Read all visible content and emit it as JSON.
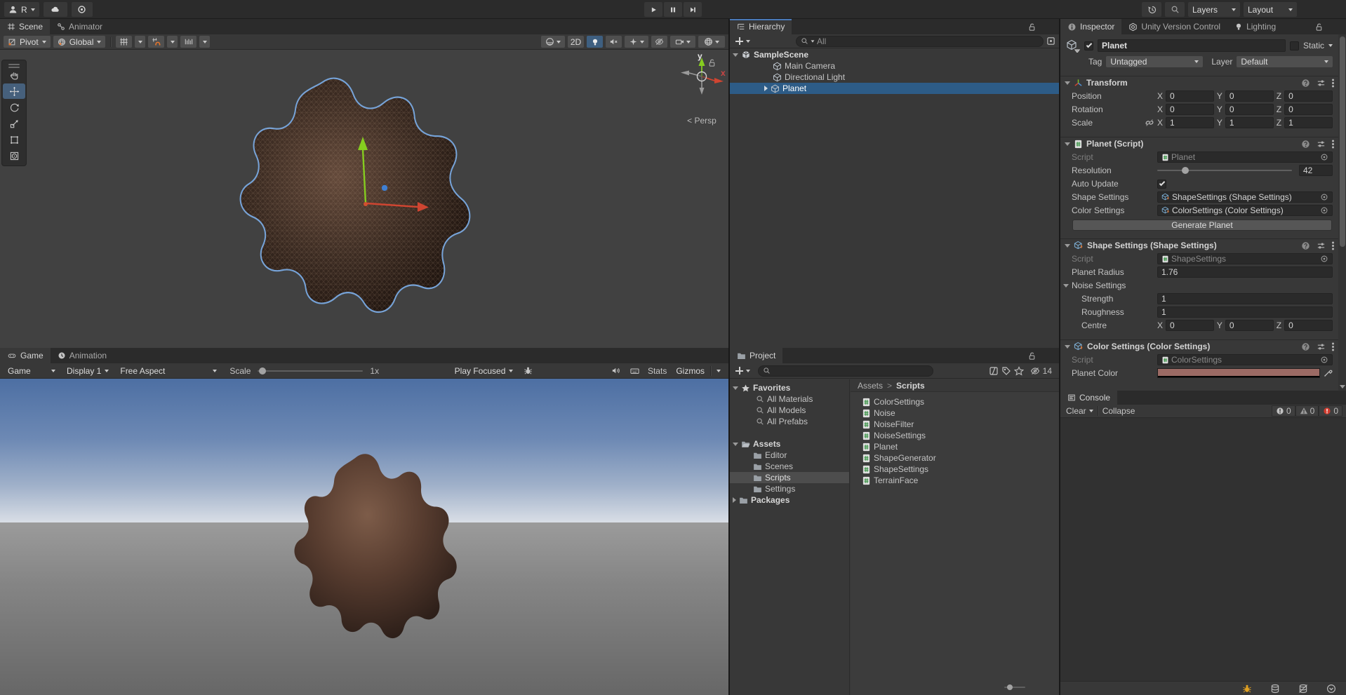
{
  "colors": {
    "selection_blue": "#2d5c87",
    "tab_focus_line": "#4a79b8",
    "planet_color_swatch": "#9b6a64",
    "axis_green": "#85cc1f",
    "axis_red": "#cf4531",
    "sky_top": "#4d6fa3"
  },
  "topbar": {
    "account": "R",
    "layers": "Layers",
    "layout": "Layout"
  },
  "scene": {
    "tab": "Scene",
    "tab2": "Animator",
    "pivot": "Pivot",
    "global": "Global",
    "mode2d": "2D",
    "persp": "< Persp",
    "axis_x": "x",
    "axis_y": "y"
  },
  "game": {
    "tab": "Game",
    "tab2": "Animation",
    "target": "Game",
    "display": "Display 1",
    "aspect": "Free Aspect",
    "scale_label": "Scale",
    "scale_value": "1x",
    "focus": "Play Focused",
    "stats": "Stats",
    "gizmos": "Gizmos"
  },
  "hierarchy": {
    "tab": "Hierarchy",
    "search": "All",
    "items": [
      {
        "label": "SampleScene"
      },
      {
        "label": "Main Camera"
      },
      {
        "label": "Directional Light"
      },
      {
        "label": "Planet"
      }
    ]
  },
  "project": {
    "tab": "Project",
    "favorites": "Favorites",
    "fav_items": [
      "All Materials",
      "All Models",
      "All Prefabs"
    ],
    "assets": "Assets",
    "folders": [
      "Editor",
      "Scenes",
      "Scripts",
      "Settings"
    ],
    "packages": "Packages",
    "crumb1": "Assets",
    "crumb_sep": ">",
    "crumb2": "Scripts",
    "hidden_count": "14",
    "scripts": [
      "ColorSettings",
      "Noise",
      "NoiseFilter",
      "NoiseSettings",
      "Planet",
      "ShapeGenerator",
      "ShapeSettings",
      "TerrainFace"
    ]
  },
  "inspector": {
    "tab": "Inspector",
    "tab2": "Unity Version Control",
    "tab3": "Lighting",
    "name": "Planet",
    "static": "Static",
    "tag_label": "Tag",
    "tag": "Untagged",
    "layer_label": "Layer",
    "layer": "Default",
    "ax": {
      "x": "X",
      "y": "Y",
      "z": "Z"
    },
    "transform": {
      "title": "Transform",
      "position": {
        "label": "Position",
        "x": "0",
        "y": "0",
        "z": "0"
      },
      "rotation": {
        "label": "Rotation",
        "x": "0",
        "y": "0",
        "z": "0"
      },
      "scale": {
        "label": "Scale",
        "x": "1",
        "y": "1",
        "z": "1"
      }
    },
    "planet": {
      "title": "Planet (Script)",
      "script_label": "Script",
      "script": "Planet",
      "resolution_label": "Resolution",
      "resolution": "42",
      "auto_update_label": "Auto Update",
      "shape_label": "Shape Settings",
      "shape": "ShapeSettings (Shape Settings)",
      "color_label": "Color Settings",
      "color": "ColorSettings (Color Settings)",
      "generate": "Generate Planet"
    },
    "shape": {
      "title": "Shape Settings (Shape Settings)",
      "script_label": "Script",
      "script": "ShapeSettings",
      "radius_label": "Planet Radius",
      "radius": "1.76",
      "noise_label": "Noise Settings",
      "strength_label": "Strength",
      "strength": "1",
      "roughness_label": "Roughness",
      "roughness": "1",
      "centre_label": "Centre",
      "cx": "0",
      "cy": "0",
      "cz": "0"
    },
    "color": {
      "title": "Color Settings (Color Settings)",
      "script_label": "Script",
      "script": "ColorSettings",
      "planet_color_label": "Planet Color",
      "swatch": "#9b6a64"
    }
  },
  "console": {
    "tab": "Console",
    "clear": "Clear",
    "collapse": "Collapse",
    "info": "0",
    "warn": "0",
    "error": "0"
  }
}
